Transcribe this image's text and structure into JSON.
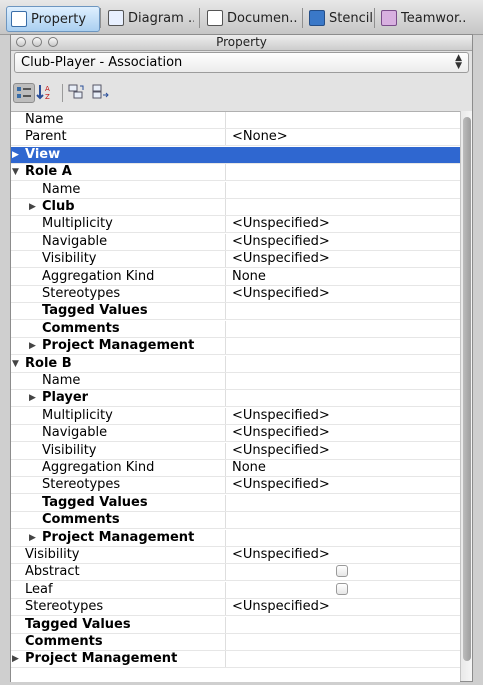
{
  "tabs": [
    {
      "label": "Property",
      "active": true,
      "icon": "property-sheet-icon"
    },
    {
      "label": "Diagram ..",
      "active": false,
      "icon": "diagram-icon"
    },
    {
      "label": "Documen..",
      "active": false,
      "icon": "document-icon"
    },
    {
      "label": "Stencil",
      "active": false,
      "icon": "stencil-star-icon"
    },
    {
      "label": "Teamwor..",
      "active": false,
      "icon": "teamwork-folder-icon"
    }
  ],
  "window": {
    "title": "Property"
  },
  "selector": {
    "value": "Club-Player - Association"
  },
  "toolbar": {
    "buttons": [
      "categorized-view-icon",
      "sort-alphabetical-icon",
      "expand-all-icon",
      "collapse-all-icon"
    ]
  },
  "rows": [
    {
      "name": "Name",
      "value": "",
      "level": 0,
      "bold": false
    },
    {
      "name": "Parent",
      "value": "<None>",
      "level": 0,
      "bold": false
    },
    {
      "name": "View",
      "value": "",
      "level": 0,
      "bold": true,
      "toggle": "collapsed",
      "selected": true
    },
    {
      "name": "Role A",
      "value": "",
      "level": 0,
      "bold": true,
      "toggle": "expanded"
    },
    {
      "name": "Name",
      "value": "",
      "level": 1,
      "bold": false
    },
    {
      "name": "Club",
      "value": "",
      "level": 1,
      "bold": true,
      "toggle": "collapsed"
    },
    {
      "name": "Multiplicity",
      "value": "<Unspecified>",
      "level": 1,
      "bold": false
    },
    {
      "name": "Navigable",
      "value": "<Unspecified>",
      "level": 1,
      "bold": false
    },
    {
      "name": "Visibility",
      "value": "<Unspecified>",
      "level": 1,
      "bold": false
    },
    {
      "name": "Aggregation Kind",
      "value": "None",
      "level": 1,
      "bold": false
    },
    {
      "name": "Stereotypes",
      "value": "<Unspecified>",
      "level": 1,
      "bold": false
    },
    {
      "name": "Tagged Values",
      "value": "",
      "level": 1,
      "bold": true
    },
    {
      "name": "Comments",
      "value": "",
      "level": 1,
      "bold": true
    },
    {
      "name": "Project Management",
      "value": "",
      "level": 1,
      "bold": true,
      "toggle": "collapsed"
    },
    {
      "name": "Role B",
      "value": "",
      "level": 0,
      "bold": true,
      "toggle": "expanded"
    },
    {
      "name": "Name",
      "value": "",
      "level": 1,
      "bold": false
    },
    {
      "name": "Player",
      "value": "",
      "level": 1,
      "bold": true,
      "toggle": "collapsed"
    },
    {
      "name": "Multiplicity",
      "value": "<Unspecified>",
      "level": 1,
      "bold": false
    },
    {
      "name": "Navigable",
      "value": "<Unspecified>",
      "level": 1,
      "bold": false
    },
    {
      "name": "Visibility",
      "value": "<Unspecified>",
      "level": 1,
      "bold": false
    },
    {
      "name": "Aggregation Kind",
      "value": "None",
      "level": 1,
      "bold": false
    },
    {
      "name": "Stereotypes",
      "value": "<Unspecified>",
      "level": 1,
      "bold": false
    },
    {
      "name": "Tagged Values",
      "value": "",
      "level": 1,
      "bold": true
    },
    {
      "name": "Comments",
      "value": "",
      "level": 1,
      "bold": true
    },
    {
      "name": "Project Management",
      "value": "",
      "level": 1,
      "bold": true,
      "toggle": "collapsed"
    },
    {
      "name": "Visibility",
      "value": "<Unspecified>",
      "level": 0,
      "bold": false
    },
    {
      "name": "Abstract",
      "value": "",
      "level": 0,
      "bold": false,
      "checkbox": true,
      "checked": false
    },
    {
      "name": "Leaf",
      "value": "",
      "level": 0,
      "bold": false,
      "checkbox": true,
      "checked": false
    },
    {
      "name": "Stereotypes",
      "value": "<Unspecified>",
      "level": 0,
      "bold": false
    },
    {
      "name": "Tagged Values",
      "value": "",
      "level": 0,
      "bold": true
    },
    {
      "name": "Comments",
      "value": "",
      "level": 0,
      "bold": true
    },
    {
      "name": "Project Management",
      "value": "",
      "level": 0,
      "bold": true,
      "toggle": "collapsed"
    }
  ],
  "colors": {
    "selection": "#2f67d0",
    "active_tab": "#aacff0"
  }
}
